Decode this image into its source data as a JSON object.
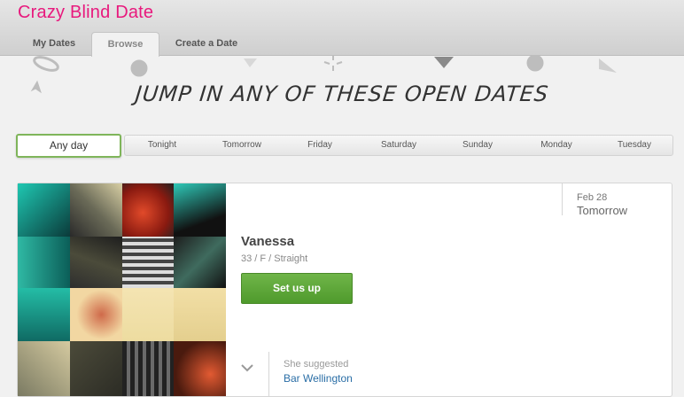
{
  "app": {
    "title": "Crazy Blind Date"
  },
  "tabs": [
    {
      "label": "My Dates",
      "active": false
    },
    {
      "label": "Browse",
      "active": true
    },
    {
      "label": "Create a Date",
      "active": false
    }
  ],
  "hero": {
    "title": "JUMP IN ANY OF THESE OPEN DATES"
  },
  "day_filter": {
    "selected": "Any day",
    "options": [
      "Tonight",
      "Tomorrow",
      "Friday",
      "Saturday",
      "Sunday",
      "Monday",
      "Tuesday"
    ]
  },
  "card": {
    "name": "Vanessa",
    "meta": "33 / F / Straight",
    "button": "Set us up",
    "date_month": "Feb 28",
    "date_relative": "Tomorrow",
    "suggestion_label": "She suggested",
    "suggestion_place": "Bar Wellington"
  },
  "colors": {
    "brand": "#e8197d",
    "button_green": "#5aa636",
    "link": "#2a6ea6"
  },
  "icons": {
    "chevron": "chevron-down-icon"
  }
}
